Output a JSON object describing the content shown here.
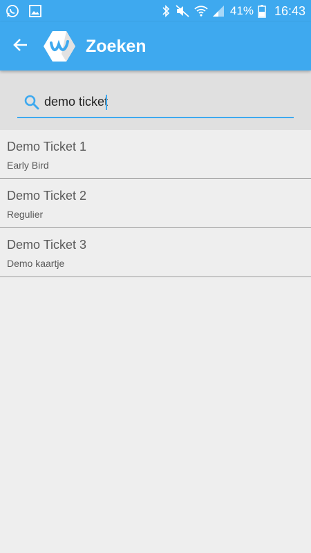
{
  "status_bar": {
    "battery_percent": "41%",
    "time": "16:43",
    "icons": [
      "whatsapp-icon",
      "image-icon",
      "bluetooth-icon",
      "mute-icon",
      "wifi-icon",
      "signal-icon",
      "battery-icon"
    ]
  },
  "app_bar": {
    "title": "Zoeken",
    "back_icon": "back-arrow-icon",
    "logo_icon": "app-logo-icon"
  },
  "search": {
    "value": "demo ticket"
  },
  "results": [
    {
      "title": "Demo Ticket 1",
      "subtitle": "Early Bird"
    },
    {
      "title": "Demo Ticket 2",
      "subtitle": "Regulier"
    },
    {
      "title": "Demo Ticket 3",
      "subtitle": "Demo kaartje"
    }
  ],
  "colors": {
    "primary": "#3ea9ef",
    "background": "#eeeeee",
    "search_background": "#e0e0e0",
    "text": "#5a5a5a"
  }
}
